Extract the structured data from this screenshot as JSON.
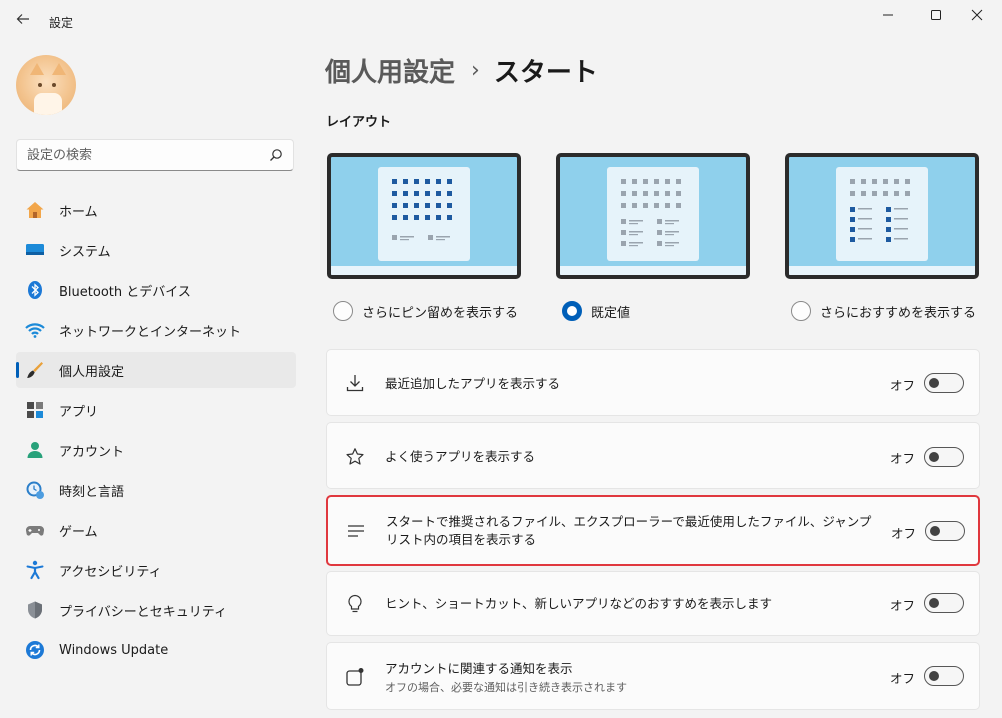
{
  "window": {
    "title": "設定",
    "back_icon": "back-arrow-icon",
    "controls": [
      "minimize-icon",
      "maximize-icon",
      "close-icon"
    ]
  },
  "search": {
    "placeholder": "設定の検索",
    "icon": "search-icon"
  },
  "sidebar": {
    "items": [
      {
        "label": "ホーム",
        "icon": "home-icon",
        "active": false
      },
      {
        "label": "システム",
        "icon": "system-icon",
        "active": false
      },
      {
        "label": "Bluetooth とデバイス",
        "icon": "bluetooth-icon",
        "active": false
      },
      {
        "label": "ネットワークとインターネット",
        "icon": "network-icon",
        "active": false
      },
      {
        "label": "個人用設定",
        "icon": "personalization-icon",
        "active": true
      },
      {
        "label": "アプリ",
        "icon": "apps-icon",
        "active": false
      },
      {
        "label": "アカウント",
        "icon": "account-icon",
        "active": false
      },
      {
        "label": "時刻と言語",
        "icon": "time-language-icon",
        "active": false
      },
      {
        "label": "ゲーム",
        "icon": "gaming-icon",
        "active": false
      },
      {
        "label": "アクセシビリティ",
        "icon": "accessibility-icon",
        "active": false
      },
      {
        "label": "プライバシーとセキュリティ",
        "icon": "privacy-shield-icon",
        "active": false
      },
      {
        "label": "Windows Update",
        "icon": "windows-update-icon",
        "active": false
      }
    ]
  },
  "main": {
    "breadcrumb": {
      "parent": "個人用設定",
      "separator": "›",
      "current": "スタート"
    },
    "layout_section": {
      "title": "レイアウト",
      "options": [
        {
          "label": "さらにピン留めを表示する",
          "selected": false
        },
        {
          "label": "既定値",
          "selected": true
        },
        {
          "label": "さらにおすすめを表示する",
          "selected": false
        }
      ]
    },
    "settings": [
      {
        "label": "最近追加したアプリを表示する",
        "sub": "",
        "state": "オフ",
        "on": false,
        "icon": "download-icon",
        "highlighted": false
      },
      {
        "label": "よく使うアプリを表示する",
        "sub": "",
        "state": "オフ",
        "on": false,
        "icon": "star-icon",
        "highlighted": false
      },
      {
        "label": "スタートで推奨されるファイル、エクスプローラーで最近使用したファイル、ジャンプ リスト内の項目を表示する",
        "sub": "",
        "state": "オフ",
        "on": false,
        "icon": "list-lines-icon",
        "highlighted": true
      },
      {
        "label": "ヒント、ショートカット、新しいアプリなどのおすすめを表示します",
        "sub": "",
        "state": "オフ",
        "on": false,
        "icon": "lightbulb-icon",
        "highlighted": false
      },
      {
        "label": "アカウントに関連する通知を表示",
        "sub": "オフの場合、必要な通知は引き続き表示されます",
        "state": "オフ",
        "on": false,
        "icon": "account-notification-icon",
        "highlighted": false
      }
    ]
  },
  "colors": {
    "accent": "#005fb8",
    "highlight_border": "#e0383e",
    "preview_background": "#8fd0ec"
  }
}
